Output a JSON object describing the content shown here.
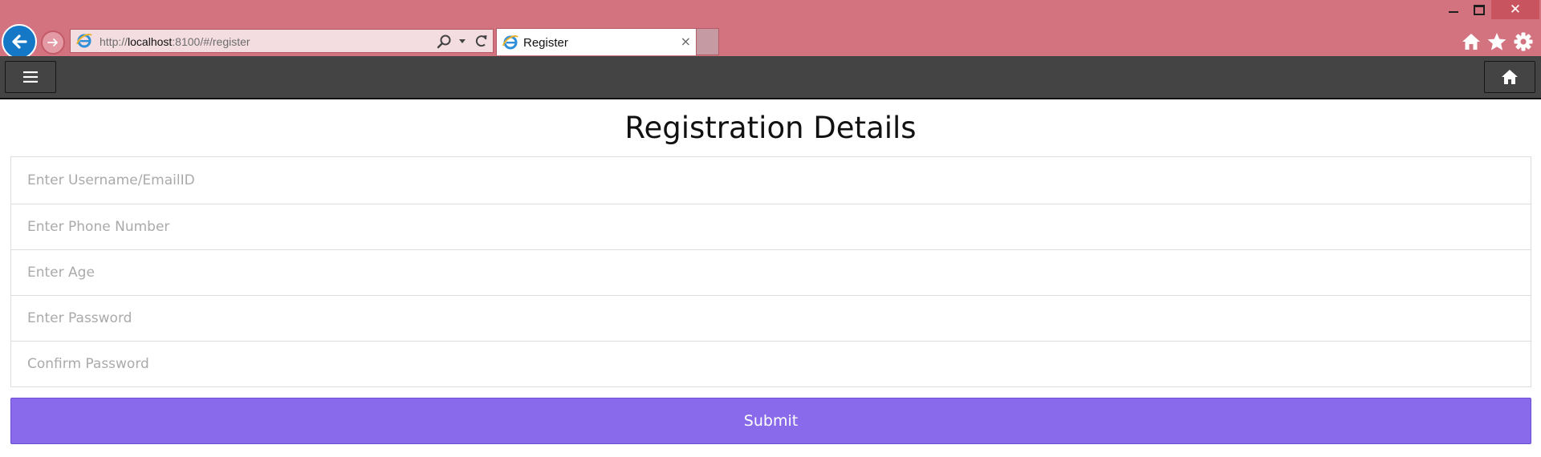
{
  "browser": {
    "window_controls": {
      "minimize_icon": "minimize-icon",
      "maximize_icon": "maximize-icon",
      "close_label": "✕"
    },
    "address_bar": {
      "url_prefix": "http://",
      "url_host": "localhost",
      "url_rest": ":8100/#/register",
      "search_icon": "search-icon",
      "refresh_icon": "refresh-icon"
    },
    "tab": {
      "title": "Register",
      "close_label": "×"
    },
    "toolbar_icons": [
      "home-icon",
      "star-icon",
      "gear-icon"
    ],
    "colors": {
      "chrome": "#d47380",
      "back_button": "#1478c6"
    }
  },
  "app": {
    "header": {
      "menu_icon": "hamburger-menu-icon",
      "home_icon": "home-icon",
      "color": "#444444"
    },
    "title": "Registration Details",
    "fields": [
      {
        "placeholder": "Enter Username/EmailID",
        "value": ""
      },
      {
        "placeholder": "Enter Phone Number",
        "value": ""
      },
      {
        "placeholder": "Enter Age",
        "value": ""
      },
      {
        "placeholder": "Enter Password",
        "value": ""
      },
      {
        "placeholder": "Confirm Password",
        "value": ""
      }
    ],
    "submit_label": "Submit",
    "colors": {
      "submit": "#886aea"
    }
  }
}
